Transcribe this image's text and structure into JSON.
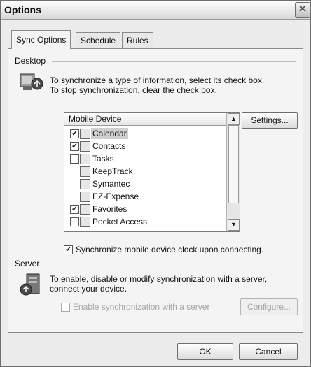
{
  "window": {
    "title": "Options",
    "close_glyph": "✕"
  },
  "tabs": [
    {
      "label": "Sync Options",
      "active": true
    },
    {
      "label": "Schedule",
      "active": false
    },
    {
      "label": "Rules",
      "active": false
    }
  ],
  "desktop": {
    "group_label": "Desktop",
    "description_1": "To synchronize a type of information, select its check box.",
    "description_2": "To stop synchronization, clear the check box.",
    "list_header": "Mobile Device",
    "settings_button": "Settings...",
    "items": [
      {
        "label": "Calendar",
        "checked": true,
        "has_checkbox": true,
        "selected": true,
        "icon": "calendar-icon"
      },
      {
        "label": "Contacts",
        "checked": true,
        "has_checkbox": true,
        "selected": false,
        "icon": "contacts-icon"
      },
      {
        "label": "Tasks",
        "checked": false,
        "has_checkbox": true,
        "selected": false,
        "icon": "tasks-icon"
      },
      {
        "label": "KeepTrack",
        "checked": false,
        "has_checkbox": false,
        "selected": false,
        "icon": "keeptrack-icon"
      },
      {
        "label": "Symantec",
        "checked": false,
        "has_checkbox": false,
        "selected": false,
        "icon": "symantec-icon"
      },
      {
        "label": "EZ-Expense",
        "checked": false,
        "has_checkbox": false,
        "selected": false,
        "icon": "ez-expense-icon"
      },
      {
        "label": "Favorites",
        "checked": true,
        "has_checkbox": true,
        "selected": false,
        "icon": "favorites-icon"
      },
      {
        "label": "Pocket Access",
        "checked": false,
        "has_checkbox": true,
        "selected": false,
        "icon": "pocket-access-icon"
      }
    ],
    "sync_clock_label": "Synchronize mobile device clock upon connecting.",
    "sync_clock_checked": true
  },
  "server": {
    "group_label": "Server",
    "description_1": "To enable, disable or modify synchronization with a server,",
    "description_2": "connect your device.",
    "enable_label": "Enable synchronization with a server",
    "enable_checked": false,
    "configure_button": "Configure..."
  },
  "footer": {
    "ok_label": "OK",
    "cancel_label": "Cancel"
  }
}
